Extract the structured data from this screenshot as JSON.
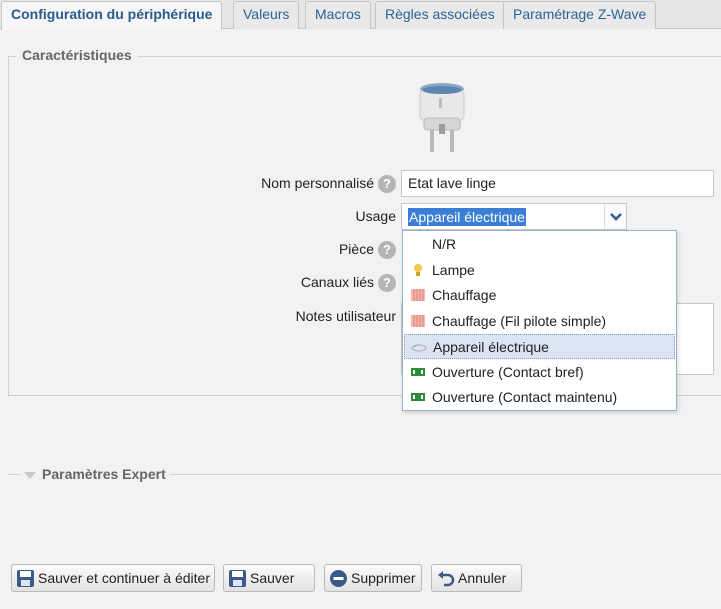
{
  "tabs": [
    {
      "label": "Configuration du périphérique",
      "active": true
    },
    {
      "label": "Valeurs"
    },
    {
      "label": "Macros"
    },
    {
      "label": "Règles associées"
    },
    {
      "label": "Paramétrage Z-Wave"
    }
  ],
  "section": {
    "legend": "Caractéristiques",
    "name_label": "Nom personnalisé",
    "name_value": "Etat lave linge",
    "usage_label": "Usage",
    "usage_value": "Appareil électrique",
    "room_label": "Pièce",
    "channels_label": "Canaux liés",
    "notes_label": "Notes utilisateur",
    "help_icon": "?"
  },
  "dropdown": {
    "options": [
      {
        "label": "N/R",
        "icon": "none"
      },
      {
        "label": "Lampe",
        "icon": "lightbulb-icon"
      },
      {
        "label": "Chauffage",
        "icon": "radiator-icon"
      },
      {
        "label": "Chauffage (Fil pilote simple)",
        "icon": "radiator-icon"
      },
      {
        "label": "Appareil électrique",
        "icon": "plug-icon",
        "selected": true
      },
      {
        "label": "Ouverture (Contact bref)",
        "icon": "contact-icon"
      },
      {
        "label": "Ouverture (Contact maintenu)",
        "icon": "contact-icon"
      }
    ]
  },
  "expert": {
    "label": "Paramètres Expert"
  },
  "buttons": {
    "save_continue": "Sauver et continuer à éditer",
    "save": "Sauver",
    "delete": "Supprimer",
    "cancel": "Annuler"
  },
  "colors": {
    "tab_text": "#2a6496",
    "selection": "#3b7ed6",
    "selected_option": "#dbe4f3"
  }
}
